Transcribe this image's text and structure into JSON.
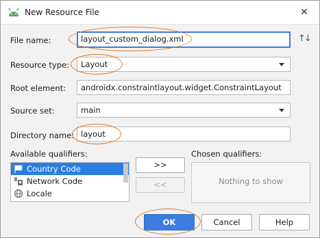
{
  "window": {
    "title": "New Resource File",
    "close_icon": "close-icon",
    "app_icon": "android-icon"
  },
  "form": {
    "file_name": {
      "label": "File name:",
      "value": "layout_custom_dialog.xml"
    },
    "resource_type": {
      "label": "Resource type:",
      "value": "Layout"
    },
    "root_element": {
      "label": "Root element:",
      "value": "androidx.constraintlayout.widget.ConstraintLayout"
    },
    "source_set": {
      "label": "Source set:",
      "value": "main"
    },
    "directory_name": {
      "label": "Directory name:",
      "value": "layout"
    }
  },
  "qualifiers": {
    "available_label": "Available qualifiers:",
    "chosen_label": "Chosen qualifiers:",
    "available": [
      {
        "label": "Country Code",
        "icon": "flag-icon",
        "selected": true
      },
      {
        "label": "Network Code",
        "icon": "network-icon",
        "selected": false
      },
      {
        "label": "Locale",
        "icon": "globe-icon",
        "selected": false
      }
    ],
    "add_label": ">>",
    "remove_label": "<<",
    "chosen_empty": "Nothing to show"
  },
  "buttons": {
    "ok": "OK",
    "cancel": "Cancel",
    "help": "Help"
  },
  "colors": {
    "accent": "#3b7de0",
    "highlight": "#e8781e",
    "selection": "#2b7de0"
  }
}
